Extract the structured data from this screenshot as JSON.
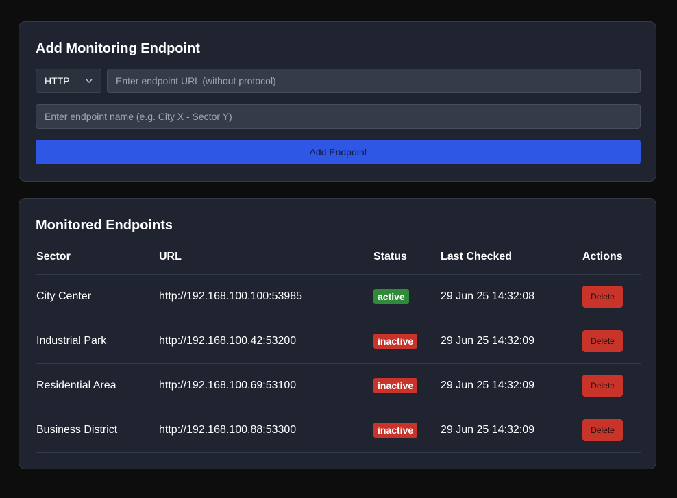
{
  "add_form": {
    "title": "Add Monitoring Endpoint",
    "protocol_value": "HTTP",
    "url_placeholder": "Enter endpoint URL (without protocol)",
    "name_placeholder": "Enter endpoint name (e.g. City X - Sector Y)",
    "add_button_label": "Add Endpoint",
    "accent_color": "#2f57e6"
  },
  "list": {
    "title": "Monitored Endpoints",
    "columns": [
      "Sector",
      "URL",
      "Status",
      "Last Checked",
      "Actions"
    ],
    "rows": [
      {
        "sector": "City Center",
        "url": "http://192.168.100.100:53985",
        "status": "active",
        "last_checked": "29 Jun 25 14:32:08",
        "action": "Delete"
      },
      {
        "sector": "Industrial Park",
        "url": "http://192.168.100.42:53200",
        "status": "inactive",
        "last_checked": "29 Jun 25 14:32:09",
        "action": "Delete"
      },
      {
        "sector": "Residential Area",
        "url": "http://192.168.100.69:53100",
        "status": "inactive",
        "last_checked": "29 Jun 25 14:32:09",
        "action": "Delete"
      },
      {
        "sector": "Business District",
        "url": "http://192.168.100.88:53300",
        "status": "inactive",
        "last_checked": "29 Jun 25 14:32:09",
        "action": "Delete"
      }
    ],
    "status_colors": {
      "active": "#2f8a3a",
      "inactive": "#c8342a"
    },
    "delete_color": "#c8342a"
  },
  "icons": {
    "protocol_dropdown": "chevron-down-icon"
  }
}
